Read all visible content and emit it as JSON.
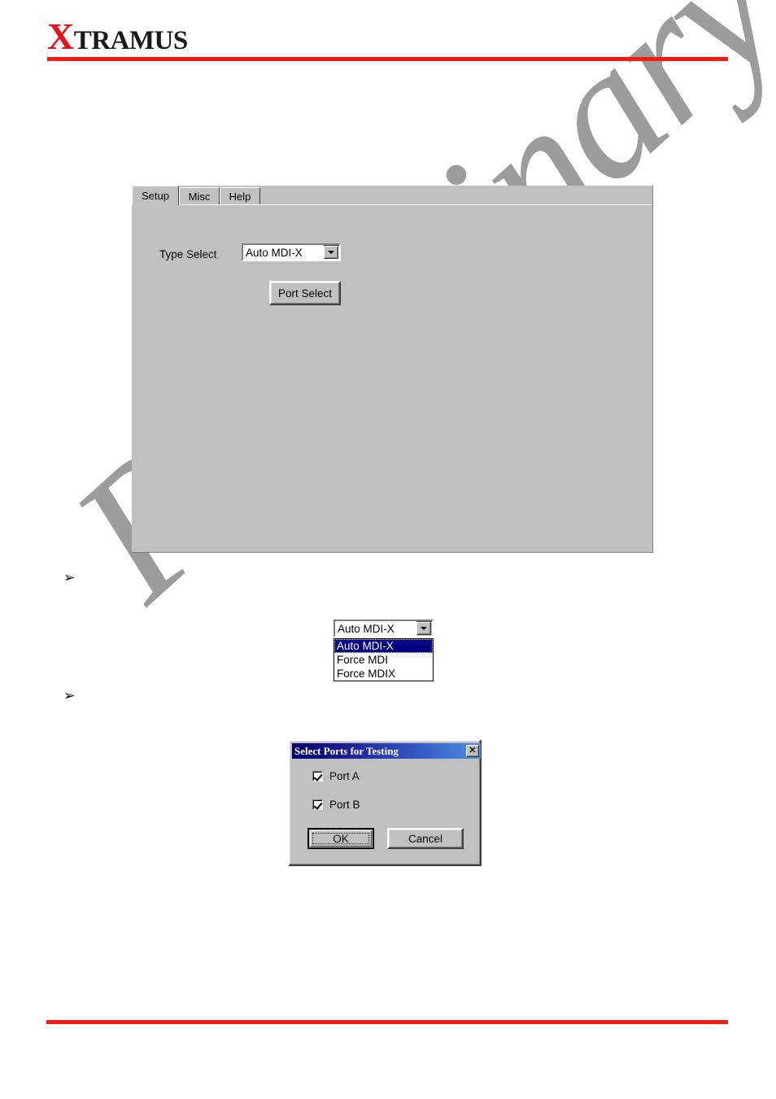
{
  "header": {
    "logo_x": "X",
    "logo_rest": "TRAMUS"
  },
  "watermark": {
    "text": "Preliminary"
  },
  "main_panel": {
    "tabs": [
      {
        "label": "Setup",
        "active": true
      },
      {
        "label": "Misc",
        "active": false
      },
      {
        "label": "Help",
        "active": false
      }
    ],
    "type_select_label": "Type Select",
    "type_select_value": "Auto MDI-X",
    "port_select_button": "Port Select"
  },
  "bullets": {
    "first": "➢",
    "second": "➢"
  },
  "dropdown": {
    "value": "Auto MDI-X",
    "options": [
      {
        "label": "Auto MDI-X",
        "selected": true
      },
      {
        "label": "Force MDI",
        "selected": false
      },
      {
        "label": "Force MDIX",
        "selected": false
      }
    ]
  },
  "dialog": {
    "title": "Select Ports for Testing",
    "close_label": "✕",
    "checkboxes": [
      {
        "label": "Port A",
        "checked": true
      },
      {
        "label": "Port B",
        "checked": true
      }
    ],
    "ok_label": "OK",
    "cancel_label": "Cancel"
  },
  "colors": {
    "brand_red": "#f41b10",
    "logo_x_red": "#e8131a",
    "watermark_grey": "#9c9c9c",
    "win_face": "#c0c0c0",
    "titlebar_dark": "#00006b",
    "titlebar_light": "#4d8fe0",
    "selection_blue": "#000080"
  }
}
